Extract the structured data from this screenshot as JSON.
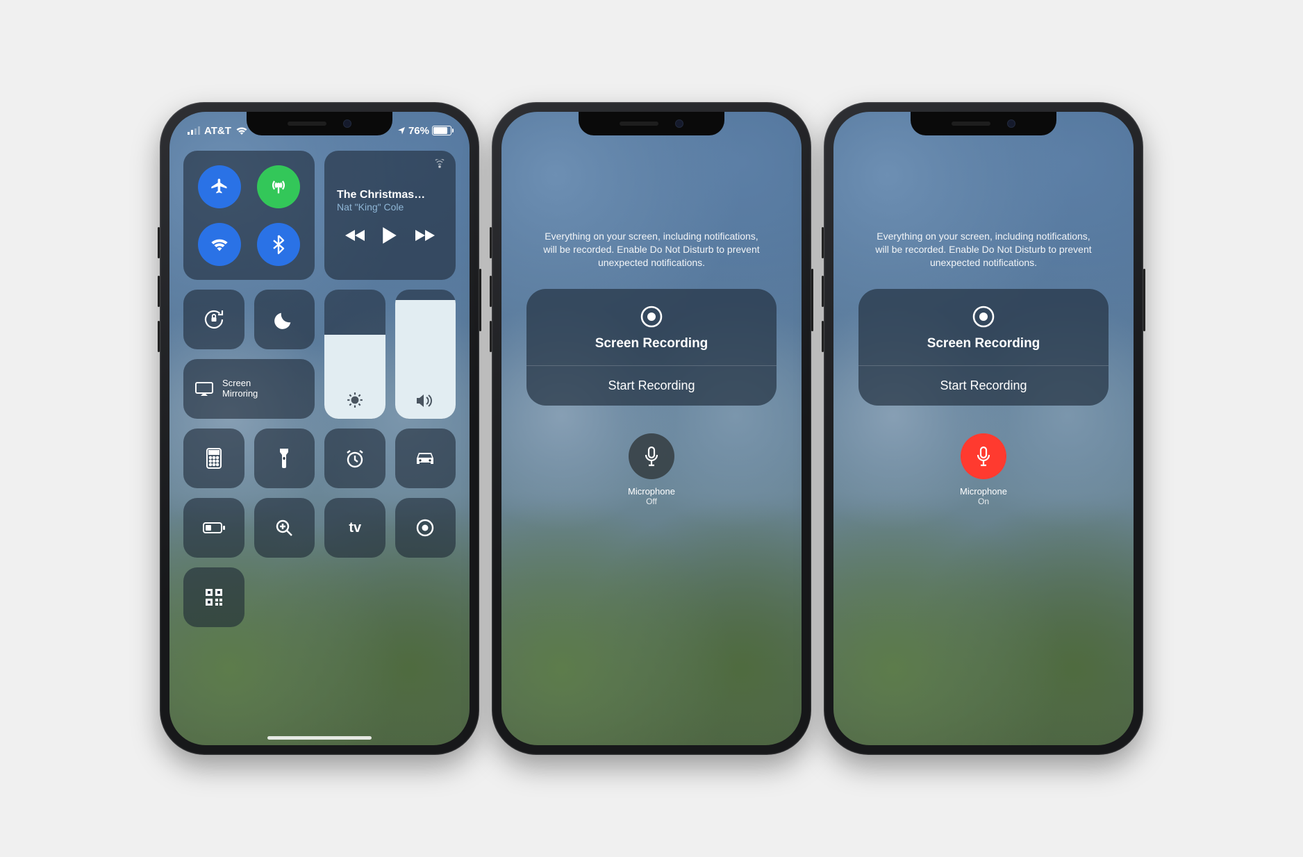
{
  "status": {
    "carrier": "AT&T",
    "battery_text": "76%",
    "battery_fill_pct": 76
  },
  "cc": {
    "media_title": "The Christmas…",
    "media_artist": "Nat \"King\" Cole",
    "mirror_line1": "Screen",
    "mirror_line2": "Mirroring",
    "brightness_pct": 65,
    "volume_pct": 92,
    "tiles": {
      "airplane": "airplane-mode",
      "cellular": "cellular-data",
      "wifi": "wifi",
      "bluetooth": "bluetooth",
      "lock": "rotation-lock",
      "dnd": "do-not-disturb",
      "calculator": "calculator",
      "flashlight": "flashlight",
      "alarm": "alarm",
      "car": "driving-mode",
      "low_power": "low-power-mode",
      "magnifier": "magnifier",
      "appletv": "apple-tv-remote",
      "record": "screen-recording",
      "qr": "qr-scanner"
    }
  },
  "rec": {
    "disclaimer": "Everything on your screen, including notifications, will be recorded. Enable Do Not Disturb to prevent unexpected notifications.",
    "title": "Screen Recording",
    "action": "Start Recording",
    "mic_label": "Microphone",
    "mic_off": "Off",
    "mic_on": "On"
  }
}
